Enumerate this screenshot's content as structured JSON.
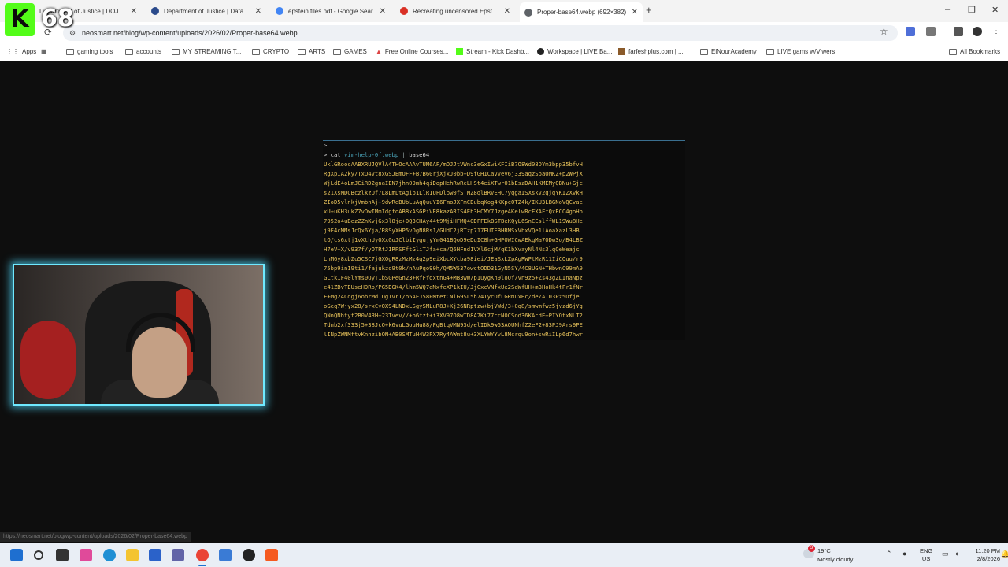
{
  "badge": {
    "letter": "K",
    "count": "68"
  },
  "tabs": [
    {
      "title": "Department of Justice | DOJ Di",
      "color": "#2b4a8b"
    },
    {
      "title": "Department of Justice | Data Se",
      "color": "#2b4a8b"
    },
    {
      "title": "epstein files pdf - Google Sear",
      "color": "#4285f4"
    },
    {
      "title": "Recreating uncensored Epstein",
      "color": "#d93025"
    },
    {
      "title": "Proper-base64.webp (692×382)",
      "color": "#5f6368"
    }
  ],
  "window_controls": {
    "minimize": "–",
    "maximize": "❐",
    "close": "✕"
  },
  "nav": {
    "back": "←",
    "forward": "→",
    "reload": "⟳"
  },
  "url": "neosmart.net/blog/wp-content/uploads/2026/02/Proper-base64.webp",
  "bookmarks": [
    {
      "label": "Apps"
    },
    {
      "label": ""
    },
    {
      "label": "gaming tools"
    },
    {
      "label": "accounts"
    },
    {
      "label": "MY STREAMING T..."
    },
    {
      "label": "CRYPTO"
    },
    {
      "label": "ARTS"
    },
    {
      "label": "GAMES"
    },
    {
      "label": "Free Online Courses..."
    },
    {
      "label": "Stream - Kick Dashb..."
    },
    {
      "label": "Workspace | LIVE Ba..."
    },
    {
      "label": "farfeshplus.com | ..."
    },
    {
      "label": "ElNourAcademy"
    },
    {
      "label": "LIVE gams w/Viwers"
    },
    {
      "label": "All Bookmarks"
    }
  ],
  "terminal": {
    "prompt_top": ">",
    "prompt": ">",
    "cmd": "cat",
    "file": "vim-help-0f.webp",
    "pipe": "|",
    "pipe_cmd": "base64",
    "lines": [
      "UklGRoocAABXRUJQVlA4THOcAAAvTUM6AF/mOJJtVWnc3eGxIwiKFIiB7O8Wd08DYm3bpp35bfvH",
      "RgXpIA2ky/TxU4Vt8xGSJEmOFF+B7B60rjXjxJ0bb+D9fGH1CavVev6j339aqzSoaOMKZ+p2WPjX",
      "WjLdE4oLmJCiRD2gnaIEN7jhn09mh4qiDopHehRwRcLHSt4eiXTwrO1bEszDAH1KMEMyQBNu+Gjc",
      "s21XsMDCBczlkzOf7L8LmLtAgib1LlR1UFDlow0fSTMZ8qlBRVEHC7yqgaISXskV2qjqYKIZXvkH",
      "ZIoD5vlnkjVmbnAj+9dwReBUbLuAqQuuYI6FmoJXFmCBubqKog4KKpcOT24k/IKU3LBGNoVQCvae",
      "xU+uKH3ukZ7vDwIMmIdgfoAB8xASGPiVE8kazARIS4Eb3HCMY7JzgeAKelwRcEXAFfQxECC4goHb",
      "7952o4uBezZZnKvjGx3l8je+0Q3CHAy44t9MjiHFMQ4GDFFEkBSTBeKQyL6SnCEslffWL19Wu8He",
      "j9E4cMMsJcQx6Yja/R8SyXHP5vOgN8Rs1/GUdC2jRTzp717EUTEBHRMSxVbxVQe1lAoaXazL3HB",
      "tO/cs6xtj1vXthUyOXxGoJClbiIygujyYm041BQoD9eDqIC8h+GHPOWICwAEkgMa7ODw3o/B4LBZ",
      "H7eV+X/v937f/yOTRtJIRPSFftGliTJfa+ca/Q6HFnd1VXl6cjM/qK1bXvayNl4Ns3lqQeWeajc",
      "LnM6y8xbZu5CSC7jGXOgR8zMzMz4q2p9eiXbcXYcba98iei/JEaSxLZpAgRWPtMzR11IiCQuu/r9",
      "75bp9in19ti1/fajukzo9t0k/nAuPqo90h/QM5W537owctODD31GyN5SY/4C8UGN+THbwnC99mA9",
      "GLtk1F40lYms0QyT1bSGPeGn23+RfFfdxtnG4+MB3wW/p1uygKn9loOf/vn9z5+Zs43gZLInaNpz",
      "c41ZBvTEUseH9Ro/PG5DGK4/lhm5WQ7eMxfeXP1kIU/JjCxcVNfxUe2SqWfUH+m3HoHk4tPr1fNr",
      "F+Mg24Cogj6obrMdTQg1vrT/o5AEJ58PMtetCNlG9SL5h74IycOfLGRmuxHc/de/AT03Pz5OfjeC",
      "oGeq7Wjyx28/srxCvOX94LNDxLSgySMLuR8J+Kj26NRptzw+bjVWd/3+0q8/smwmfwz5jvzd6jYg",
      "QNnQNhtyf2B0V4RH+23Tvev//+b6fzt+i3XV97O8wTD8A7Ki77ccN0CSod36KAcdE+PIYOtxNLT2",
      "Tdnb2xf333j5+38JcO+k6vuLGouHu88/FgBtqVMN93d/elIDk9w53AOUNhfZ2eF2+83PJ9Ars9PE",
      "lINpZWNMftvKnnzibON+AB0SMTuH4W3PX7Ry4AWmt8u+3XLYWYYvL8Mcrqu9on+swRiILp6d7hwr"
    ]
  },
  "status_url": "https://neosmart.net/blog/wp-content/uploads/2026/02/Proper-base64.webp",
  "weather": {
    "alert_count": "3",
    "temp": "19°C",
    "condition": "Mostly cloudy"
  },
  "tray": {
    "lang_line1": "ENG",
    "lang_line2": "US",
    "time": "11:20 PM",
    "date": "2/8/2026"
  }
}
